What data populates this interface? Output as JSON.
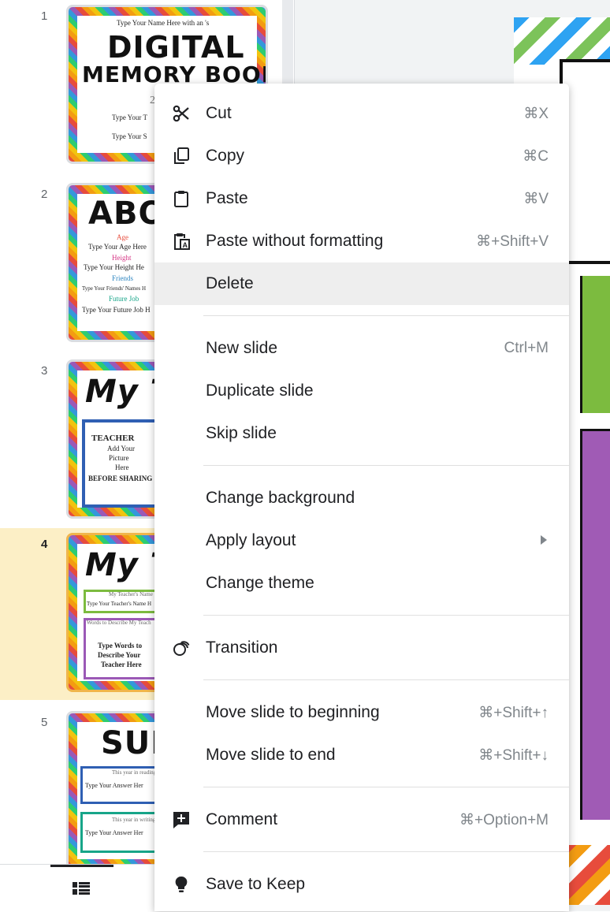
{
  "filmstrip": {
    "slides": [
      {
        "number": "1",
        "heading": "DIGITAL",
        "heading2": "MEMORY BOOK",
        "line1": "Type Your Name Here with an 's",
        "line2": "20",
        "line3": "Type Your T",
        "line4": "Type Your S"
      },
      {
        "number": "2",
        "heading": "ABOUT",
        "line1": "Age",
        "line2": "Type Your Age Here",
        "line3": "Height",
        "line4": "Type Your Height He",
        "line5": "Friends",
        "line6": "Type Your Friends' Names H",
        "line7": "Future Job",
        "line8": "Type Your Future Job H"
      },
      {
        "number": "3",
        "heading": "My T",
        "line1": "TEACHER",
        "line2": "Add Your",
        "line3": "Picture",
        "line4": "Here",
        "line5": "BEFORE SHARING"
      },
      {
        "number": "4",
        "heading": "My T",
        "line1": "My Teacher's Name",
        "line2": "Type Your Teacher's Name H",
        "line3": "Words to Describe My Teach",
        "line4": "Type Words to",
        "line5": "Describe Your",
        "line6": "Teacher Here"
      },
      {
        "number": "5",
        "heading": "SUB",
        "line1": "This year in reading",
        "line2": "Type Your Answer Her",
        "line3": "This year in writing",
        "line4": "Type Your Answer Her"
      }
    ]
  },
  "context_menu": {
    "items": [
      {
        "label": "Cut",
        "shortcut": "⌘X",
        "icon": "scissors-icon"
      },
      {
        "label": "Copy",
        "shortcut": "⌘C",
        "icon": "copy-icon"
      },
      {
        "label": "Paste",
        "shortcut": "⌘V",
        "icon": "clipboard-icon"
      },
      {
        "label": "Paste without formatting",
        "shortcut": "⌘+Shift+V",
        "icon": "paste-plain-icon"
      },
      {
        "label": "Delete",
        "shortcut": "",
        "icon": ""
      },
      {
        "label": "New slide",
        "shortcut": "Ctrl+M",
        "icon": ""
      },
      {
        "label": "Duplicate slide",
        "shortcut": "",
        "icon": ""
      },
      {
        "label": "Skip slide",
        "shortcut": "",
        "icon": ""
      },
      {
        "label": "Change background",
        "shortcut": "",
        "icon": ""
      },
      {
        "label": "Apply layout",
        "shortcut": "",
        "icon": "submenu-arrow-icon"
      },
      {
        "label": "Change theme",
        "shortcut": "",
        "icon": ""
      },
      {
        "label": "Transition",
        "shortcut": "",
        "icon": "transition-icon"
      },
      {
        "label": "Move slide to beginning",
        "shortcut": "⌘+Shift+↑",
        "icon": ""
      },
      {
        "label": "Move slide to end",
        "shortcut": "⌘+Shift+↓",
        "icon": ""
      },
      {
        "label": "Comment",
        "shortcut": "⌘+Option+M",
        "icon": "add-comment-icon"
      },
      {
        "label": "Save to Keep",
        "shortcut": "",
        "icon": "lightbulb-icon"
      }
    ]
  },
  "bottom_bar": {
    "grid_view_icon": "grid-view-icon"
  },
  "colors": {
    "selected_slide_bg": "#fcefc6",
    "menu_hover": "#eeeeee",
    "shortcut_text": "#80868b"
  }
}
